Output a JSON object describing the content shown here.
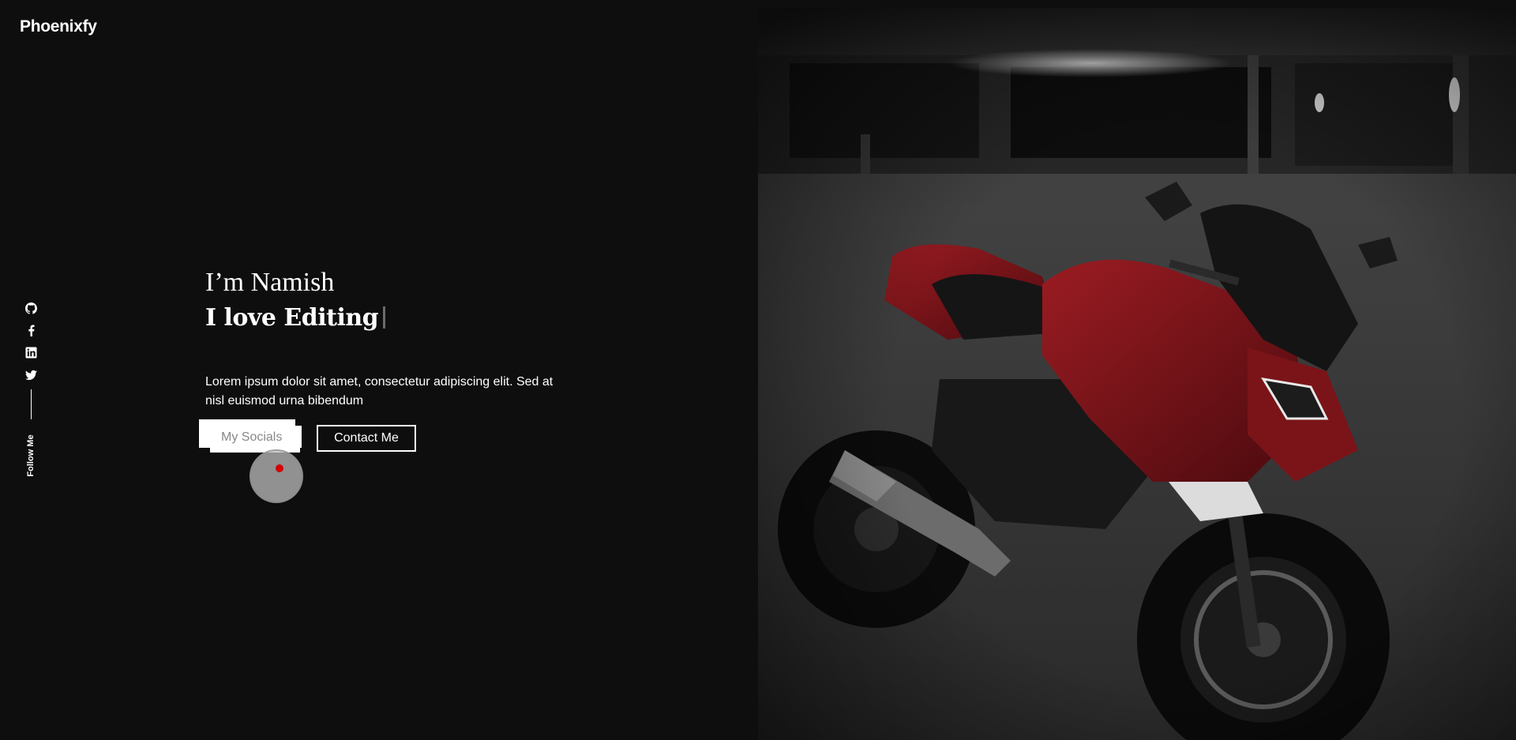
{
  "header": {
    "brand": "Phoenixfy",
    "theme_icon": "contrast-icon",
    "menu_icon": "hamburger-menu-icon"
  },
  "social_rail": {
    "icons": [
      "github-icon",
      "facebook-icon",
      "linkedin-icon",
      "twitter-icon"
    ],
    "follow_label": "Follow Me"
  },
  "hero": {
    "greeting": "I’m Namish",
    "tagline": "I love Editing",
    "intro": "Lorem ipsum dolor sit amet, consectetur adipiscing elit. Sed at nisl euismod urna bibendum",
    "primary_button": "My Socials",
    "secondary_button": "Contact Me"
  },
  "colors": {
    "background": "#0e0e0f",
    "text": "#ffffff",
    "accent": "#d40000",
    "motorcycle_red": "#7a1418"
  }
}
